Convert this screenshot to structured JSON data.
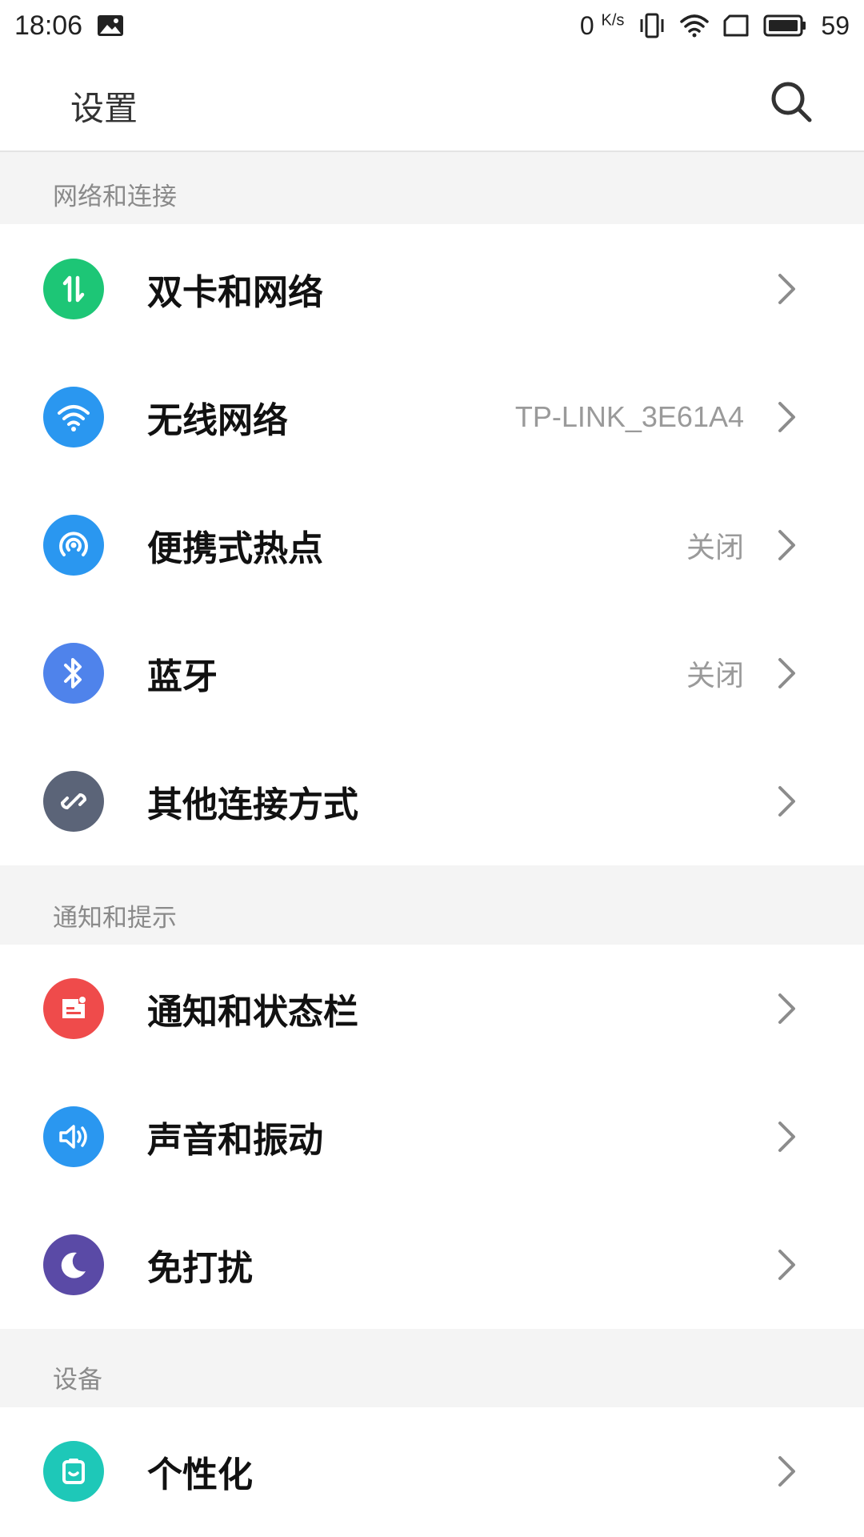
{
  "status_bar": {
    "time": "18:06",
    "net_speed_value": "0",
    "net_speed_unit": "K/s",
    "battery_percent": "59"
  },
  "header": {
    "title": "设置"
  },
  "sections": [
    {
      "title": "网络和连接",
      "items": [
        {
          "label": "双卡和网络",
          "value": "",
          "icon": "dual-sim-icon",
          "color": "#1dc676"
        },
        {
          "label": "无线网络",
          "value": "TP-LINK_3E61A4",
          "icon": "wifi-icon",
          "color": "#2a97f0"
        },
        {
          "label": "便携式热点",
          "value": "关闭",
          "icon": "hotspot-icon",
          "color": "#2a97f0"
        },
        {
          "label": "蓝牙",
          "value": "关闭",
          "icon": "bluetooth-icon",
          "color": "#4f83eb"
        },
        {
          "label": "其他连接方式",
          "value": "",
          "icon": "link-icon",
          "color": "#5b6478"
        }
      ]
    },
    {
      "title": "通知和提示",
      "items": [
        {
          "label": "通知和状态栏",
          "value": "",
          "icon": "notification-icon",
          "color": "#ef4b4b"
        },
        {
          "label": "声音和振动",
          "value": "",
          "icon": "sound-icon",
          "color": "#2a97f0"
        },
        {
          "label": "免打扰",
          "value": "",
          "icon": "moon-icon",
          "color": "#5a4aa6"
        }
      ]
    },
    {
      "title": "设备",
      "items": [
        {
          "label": "个性化",
          "value": "",
          "icon": "personalize-icon",
          "color": "#1ec8b8"
        }
      ]
    }
  ]
}
